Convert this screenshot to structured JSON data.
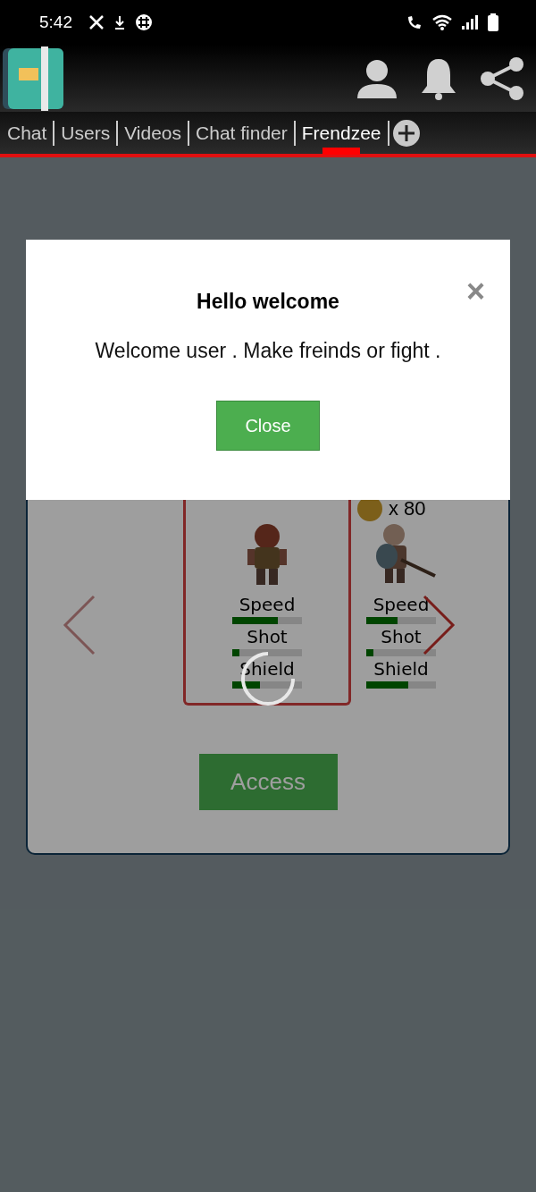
{
  "status_bar": {
    "time": "5:42"
  },
  "tabs": [
    {
      "label": "Chat",
      "selected": false
    },
    {
      "label": "Users",
      "selected": false
    },
    {
      "label": "Videos",
      "selected": false
    },
    {
      "label": "Chat finder",
      "selected": false
    },
    {
      "label": "Frendzee",
      "selected": true
    }
  ],
  "characters": [
    {
      "selected": true,
      "stats": [
        {
          "name": "Speed",
          "level": 0.65
        },
        {
          "name": "Shot",
          "level": 0.1
        },
        {
          "name": "Shield",
          "level": 0.4
        }
      ]
    },
    {
      "selected": false,
      "price": "x 80",
      "stats": [
        {
          "name": "Speed",
          "level": 0.45
        },
        {
          "name": "Shot",
          "level": 0.1
        },
        {
          "name": "Shield",
          "level": 0.6
        }
      ]
    }
  ],
  "access_button": "Access",
  "loading": true,
  "modal": {
    "title": "Hello welcome",
    "message": "Welcome user . Make freinds or fight .",
    "close_symbol": "×",
    "button": "Close"
  }
}
